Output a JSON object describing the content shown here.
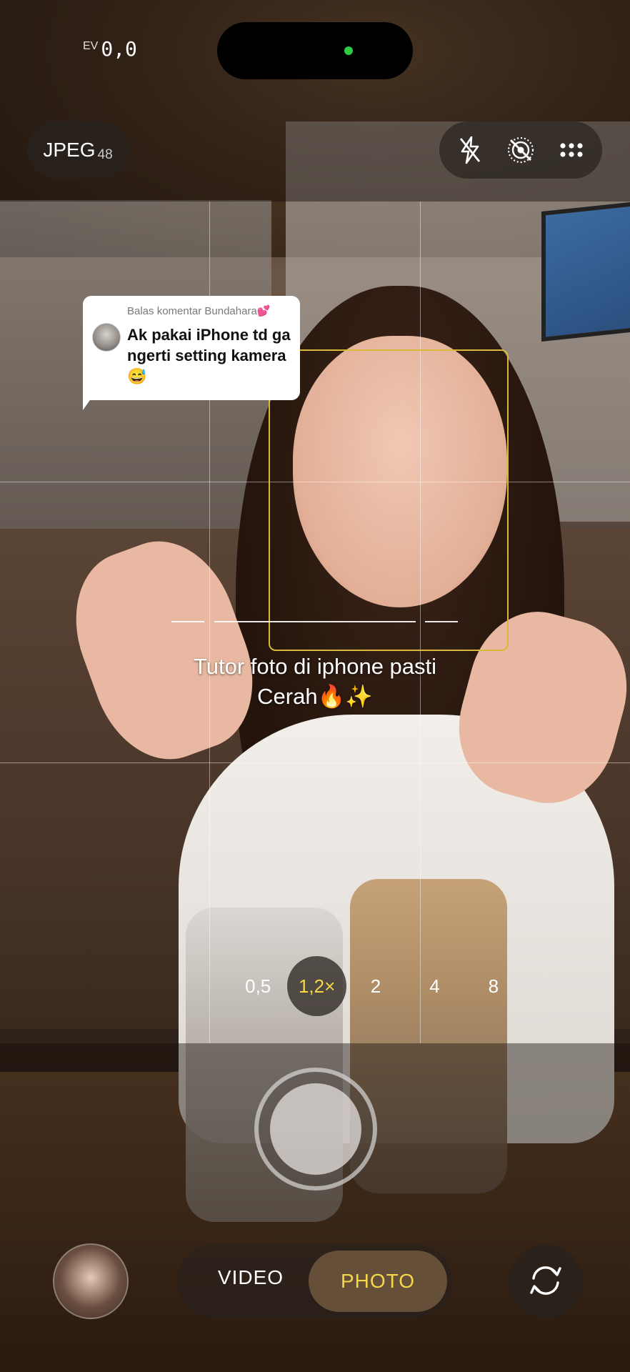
{
  "exposure": {
    "label": "EV",
    "value": "0,0"
  },
  "format": {
    "label": "JPEG",
    "megapixels": "48"
  },
  "top_controls": [
    {
      "icon": "flash-off-icon"
    },
    {
      "icon": "live-photo-off-icon"
    },
    {
      "icon": "more-options-icon"
    }
  ],
  "comment": {
    "header": "Balas komentar Bundahara💕",
    "text": "Ak pakai iPhone td ga ngerti setting kamera😅"
  },
  "caption": {
    "line1": "Tutor foto di iphone pasti",
    "line2": "Cerah🔥✨"
  },
  "zoom": {
    "options": [
      "0,5",
      "1,2×",
      "2",
      "4",
      "8"
    ],
    "selected": "1,2×"
  },
  "modes": {
    "video": "VIDEO",
    "photo": "PHOTO",
    "selected": "PHOTO"
  },
  "colors": {
    "accent_yellow": "#f4d84a",
    "focus_box": "#d9b93a",
    "status_dot": "#2ecc40"
  }
}
